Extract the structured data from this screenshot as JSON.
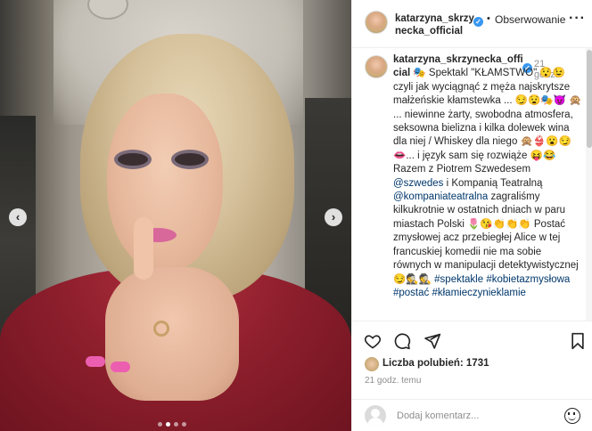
{
  "post": {
    "username": "katarzyna_skrzynecka_official",
    "header_username_line1": "katarzyna_skrzy",
    "header_username_line2": "necka_official",
    "separator": "•",
    "follow_label": "Obserwowanie",
    "more_label": "···",
    "caption_username_line1": "katarzyna_skrzynecka_offi",
    "caption_username_line2": "cial",
    "caption_time_line1": "21",
    "caption_time_line2": "godz.",
    "caption_parts": {
      "p1": " 🎭 Spektakl \"KŁAMSTWO\" 😯😉 czyli jak wyciągnąć z męża najskrytsze małżeńskie kłamstewka ... 😏😧🎭😈 🙊 ... niewinne żarty, swobodna atmosfera, seksowna bielizna i kilka dolewek wina dla niej / Whiskey dla niego 🙊👙😮😏👄... i język sam się rozwiąże 😝😂 Razem z Piotrem Szwedesem ",
      "mention1": "@szwedes",
      "p2": " i Kompanią Teatralną ",
      "mention2": "@kompaniateatralna",
      "p3": " zagraliśmy kilkukrotnie w ostatnich dniach w paru miastach Polski 🌷😘👏👏👏 Postać zmysłowej acz przebiegłej Alice w tej francuskiej komedii nie ma sobie równych w manipulacji detektywistycznej 😏🕵🕵 ",
      "tags": "#spektakle #kobietazmysłowa #postać #kłamieczynieklamie"
    },
    "likes_label": "Liczba polubień: 1731",
    "time_ago": "21 godz. temu",
    "comment_placeholder": "Dodaj komentarz...",
    "carousel": {
      "prev": "‹",
      "next": "›",
      "slides": 4,
      "active_slide": 2
    }
  },
  "colors": {
    "accent": "#3897f0",
    "link": "#00376b",
    "text": "#262626",
    "muted": "#8e8e8e",
    "nail": "#ec5fb0",
    "robe": "#8f1f2d"
  },
  "icons": [
    "verified-icon",
    "heart-icon",
    "comment-icon",
    "share-icon",
    "save-icon",
    "emoji-icon",
    "chevron-left-icon",
    "chevron-right-icon"
  ]
}
